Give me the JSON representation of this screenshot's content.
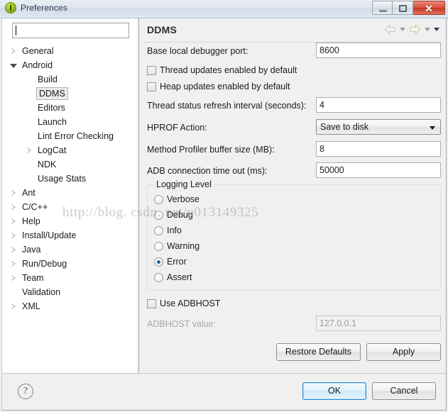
{
  "window": {
    "title": "Preferences",
    "app_icon": "eclipse-icon",
    "controls": {
      "minimize": "minimize-icon",
      "maximize": "maximize-icon",
      "close": "✕"
    }
  },
  "sidebar": {
    "filter": {
      "value": "",
      "placeholder": ""
    },
    "tree": [
      {
        "label": "General",
        "indent": 0,
        "twisty": "collapsed",
        "selected": false
      },
      {
        "label": "Android",
        "indent": 0,
        "twisty": "expanded",
        "selected": false
      },
      {
        "label": "Build",
        "indent": 1,
        "twisty": "none",
        "selected": false
      },
      {
        "label": "DDMS",
        "indent": 1,
        "twisty": "none",
        "selected": true
      },
      {
        "label": "Editors",
        "indent": 1,
        "twisty": "none",
        "selected": false
      },
      {
        "label": "Launch",
        "indent": 1,
        "twisty": "none",
        "selected": false
      },
      {
        "label": "Lint Error Checking",
        "indent": 1,
        "twisty": "none",
        "selected": false
      },
      {
        "label": "LogCat",
        "indent": 1,
        "twisty": "collapsed",
        "selected": false
      },
      {
        "label": "NDK",
        "indent": 1,
        "twisty": "none",
        "selected": false
      },
      {
        "label": "Usage Stats",
        "indent": 1,
        "twisty": "none",
        "selected": false
      },
      {
        "label": "Ant",
        "indent": 0,
        "twisty": "collapsed",
        "selected": false
      },
      {
        "label": "C/C++",
        "indent": 0,
        "twisty": "collapsed",
        "selected": false
      },
      {
        "label": "Help",
        "indent": 0,
        "twisty": "collapsed",
        "selected": false
      },
      {
        "label": "Install/Update",
        "indent": 0,
        "twisty": "collapsed",
        "selected": false
      },
      {
        "label": "Java",
        "indent": 0,
        "twisty": "collapsed",
        "selected": false
      },
      {
        "label": "Run/Debug",
        "indent": 0,
        "twisty": "collapsed",
        "selected": false
      },
      {
        "label": "Team",
        "indent": 0,
        "twisty": "collapsed",
        "selected": false
      },
      {
        "label": "Validation",
        "indent": 0,
        "twisty": "none",
        "selected": false
      },
      {
        "label": "XML",
        "indent": 0,
        "twisty": "collapsed",
        "selected": false
      }
    ]
  },
  "page": {
    "title": "DDMS",
    "nav": {
      "back": "back-arrow-icon",
      "back_menu": "chevron-down-icon",
      "forward": "forward-arrow-icon",
      "forward_menu": "chevron-down-icon",
      "view_menu": "chevron-down-icon"
    },
    "fields": {
      "base_port_label": "Base local debugger port:",
      "base_port_value": "8600",
      "thread_updates_label": "Thread updates enabled by default",
      "thread_updates_checked": false,
      "heap_updates_label": "Heap updates enabled by default",
      "heap_updates_checked": false,
      "thread_refresh_label": "Thread status refresh interval (seconds):",
      "thread_refresh_value": "4",
      "hprof_label": "HPROF Action:",
      "hprof_value": "Save to disk",
      "profiler_buffer_label": "Method Profiler buffer size (MB):",
      "profiler_buffer_value": "8",
      "adb_timeout_label": "ADB connection time out (ms):",
      "adb_timeout_value": "50000"
    },
    "logging_level": {
      "title": "Logging Level",
      "options": [
        "Verbose",
        "Debug",
        "Info",
        "Warning",
        "Error",
        "Assert"
      ],
      "selected": "Error"
    },
    "adbhost": {
      "use_label": "Use ADBHOST",
      "use_checked": false,
      "value_label": "ADBHOST value:",
      "value": "127.0.0.1",
      "value_enabled": false
    },
    "actions": {
      "restore_defaults": "Restore Defaults",
      "apply": "Apply"
    }
  },
  "footer": {
    "help": "help-icon",
    "help_glyph": "?",
    "ok": "OK",
    "cancel": "Cancel"
  },
  "watermark": {
    "text": "http://blog. csdn. net/u013149325"
  },
  "colors": {
    "accent": "#2a8ad4",
    "radio_dot": "#2b5fa8",
    "panel_bg": "#f0f0f0",
    "tree_bg": "#ffffff",
    "close_button": "#c33a23"
  }
}
